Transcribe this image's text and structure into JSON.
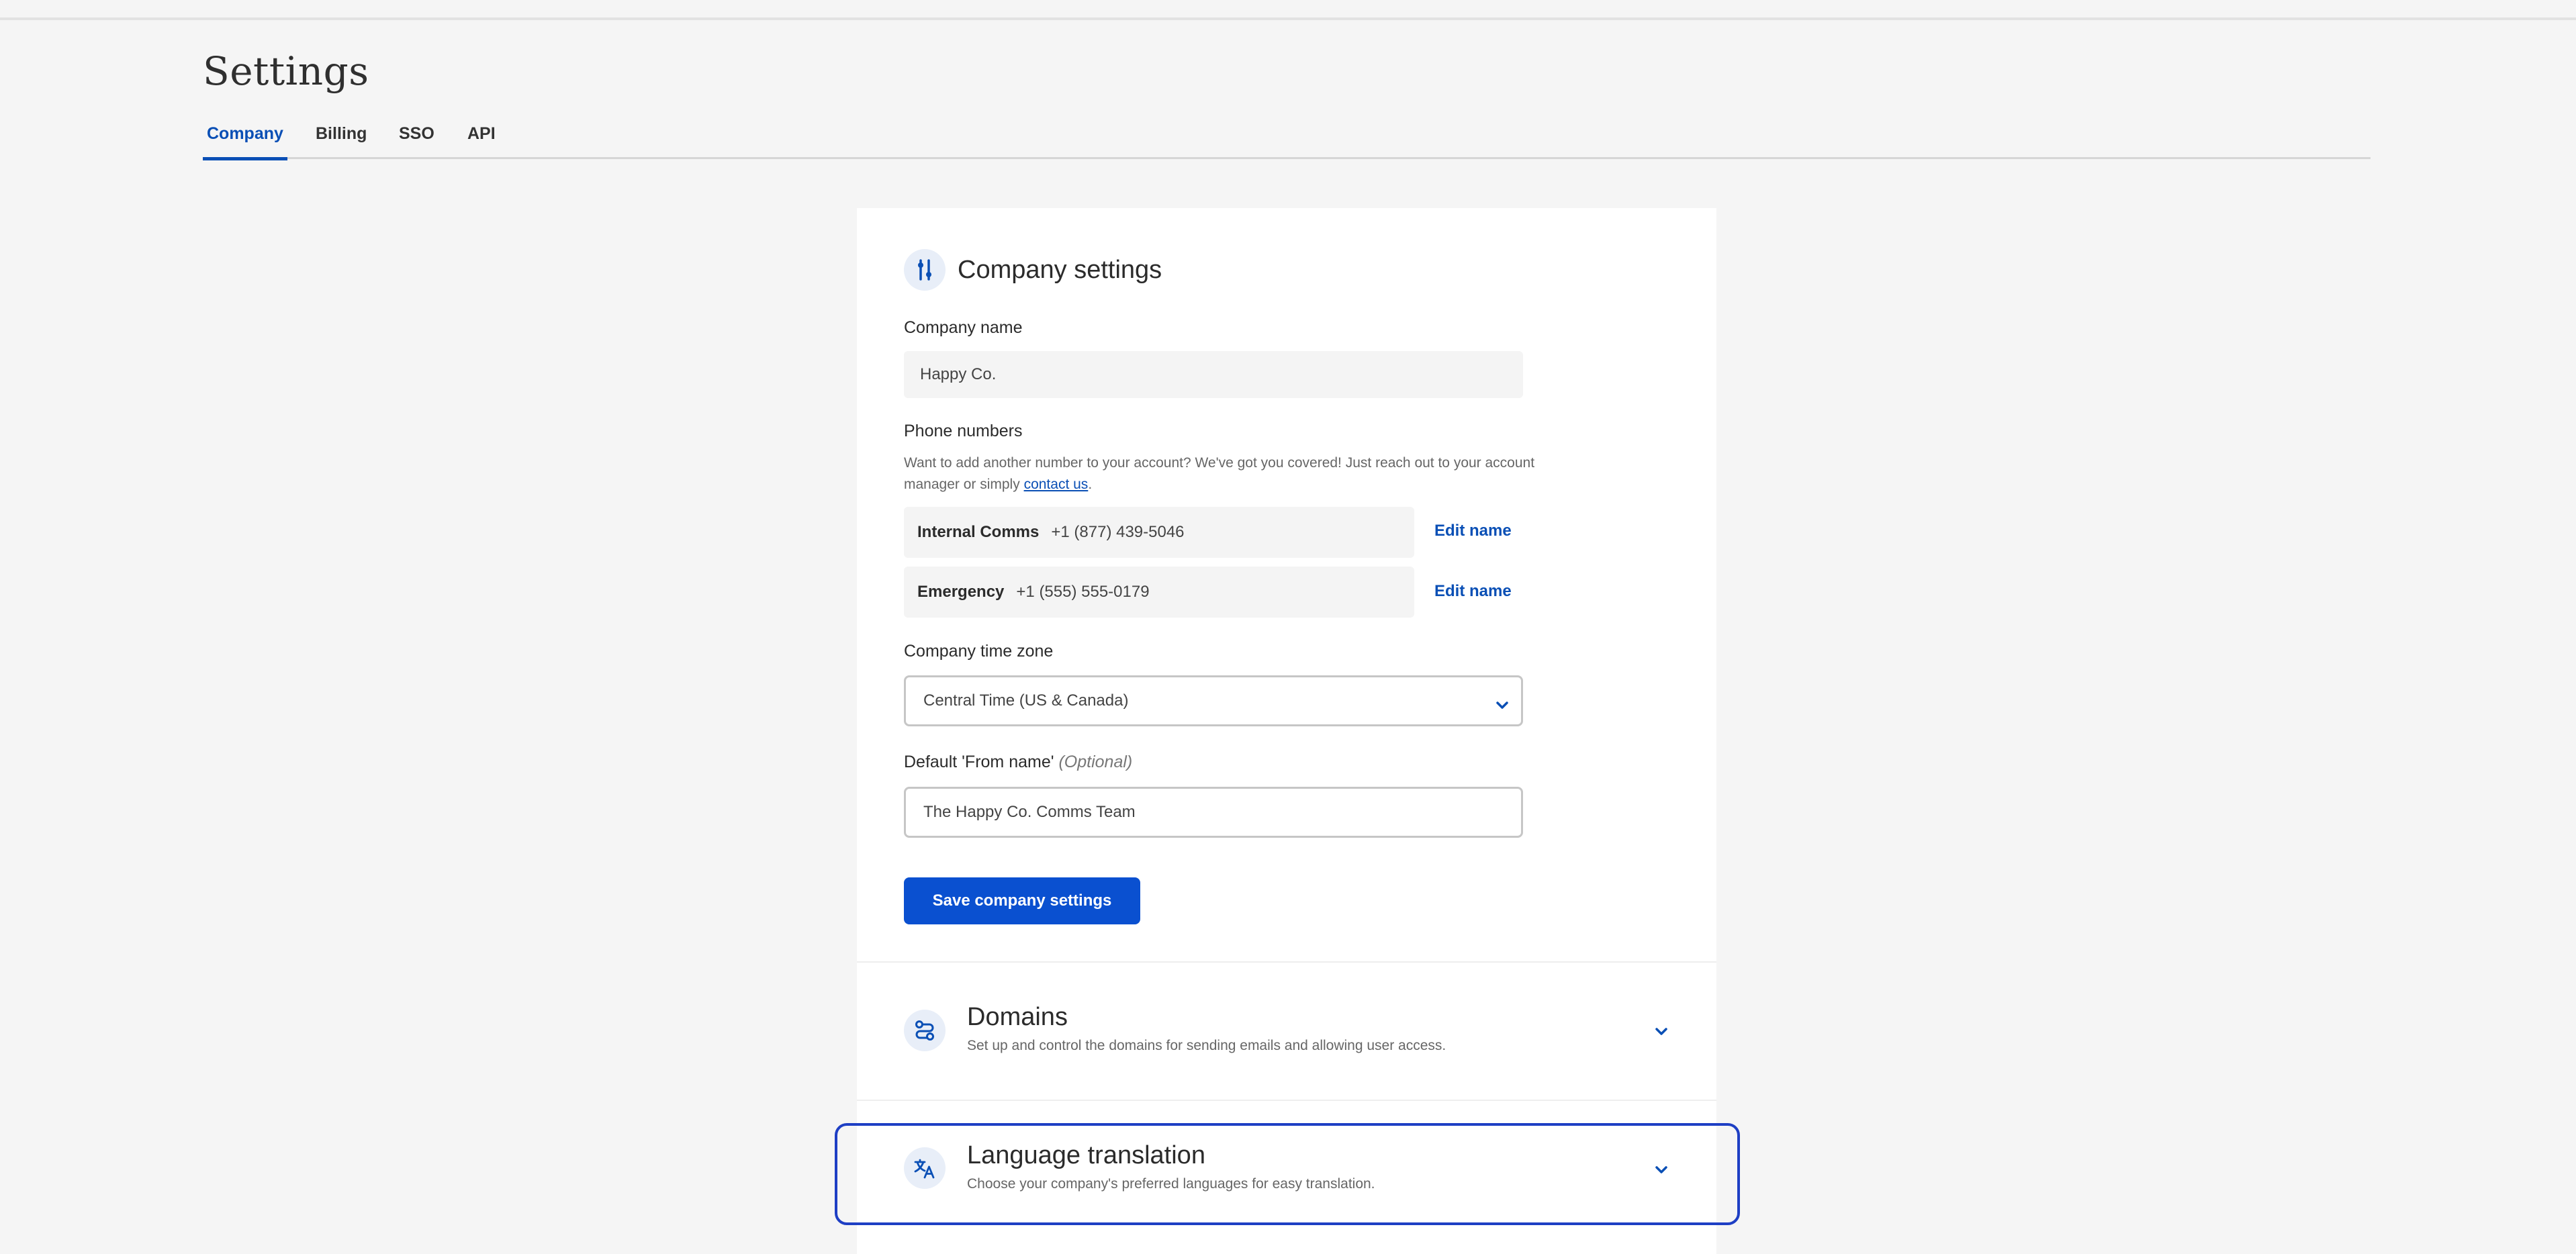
{
  "page": {
    "title": "Settings"
  },
  "tabs": [
    {
      "label": "Company",
      "active": true
    },
    {
      "label": "Billing",
      "active": false
    },
    {
      "label": "SSO",
      "active": false
    },
    {
      "label": "API",
      "active": false
    }
  ],
  "company_settings": {
    "title": "Company settings",
    "icon": "sliders-icon",
    "company_name": {
      "label": "Company name",
      "value": "Happy Co."
    },
    "phone_numbers": {
      "label": "Phone numbers",
      "help_text": "Want to add another number to your account? We've got you covered! Just reach out to your account manager or simply",
      "help_link": "contact us",
      "help_suffix": ".",
      "items": [
        {
          "name": "Internal Comms",
          "number": "+1 (877) 439-5046",
          "action": "Edit name"
        },
        {
          "name": "Emergency",
          "number": "+1 (555) 555-0179",
          "action": "Edit name"
        }
      ]
    },
    "time_zone": {
      "label": "Company time zone",
      "value": "Central Time (US & Canada)"
    },
    "from_name": {
      "label": "Default 'From name'",
      "optional": "(Optional)",
      "value": "The Happy Co. Comms Team"
    },
    "save_label": "Save company settings"
  },
  "domains": {
    "title": "Domains",
    "description": "Set up and control the domains for sending emails and allowing user access.",
    "icon": "route-icon"
  },
  "language_translation": {
    "title": "Language translation",
    "description": "Choose your company's preferred languages for easy translation.",
    "icon": "translate-icon"
  },
  "colors": {
    "accent": "#0a4fb5",
    "button": "#0a50d0",
    "focus": "#1e3fc4",
    "background": "#f5f5f5"
  }
}
